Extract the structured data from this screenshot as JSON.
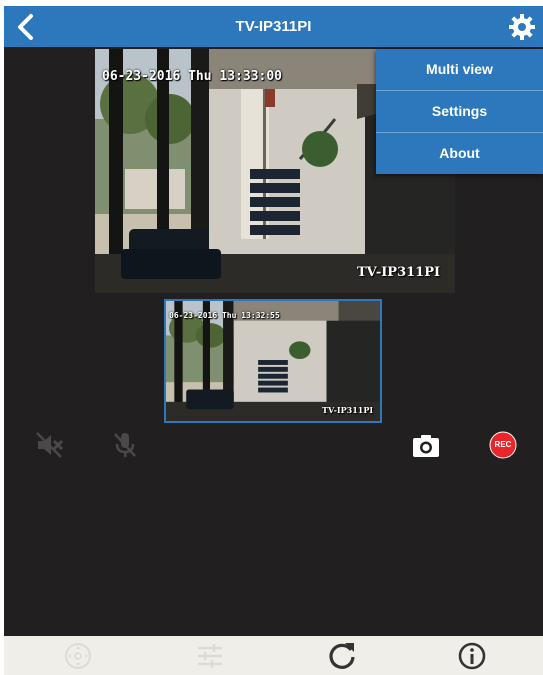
{
  "header": {
    "title": "TV-IP311PI",
    "back_icon": "chevron-left-icon",
    "settings_icon": "gear-icon"
  },
  "menu": {
    "items": [
      {
        "label": "Multi view"
      },
      {
        "label": "Settings"
      },
      {
        "label": "About"
      }
    ]
  },
  "main_feed": {
    "timestamp": "06-23-2016 Thu 13:33:00",
    "camera_label": "TV-IP311PI"
  },
  "thumbnail_feed": {
    "timestamp": "06-23-2016 Thu 13:32:55",
    "camera_label": "TV-IP311PI"
  },
  "controls": {
    "speaker_icon": "speaker-muted-icon",
    "mic_icon": "mic-muted-icon",
    "snapshot_icon": "camera-icon",
    "record_label": "REC"
  },
  "toolbar": {
    "ptz_icon": "ptz-joystick-icon",
    "adjust_icon": "sliders-icon",
    "refresh_icon": "refresh-icon",
    "info_icon": "info-icon"
  },
  "colors": {
    "accent": "#2d78bd",
    "background": "#221f20",
    "record": "#e8262b",
    "toolbar": "#efeee9"
  }
}
